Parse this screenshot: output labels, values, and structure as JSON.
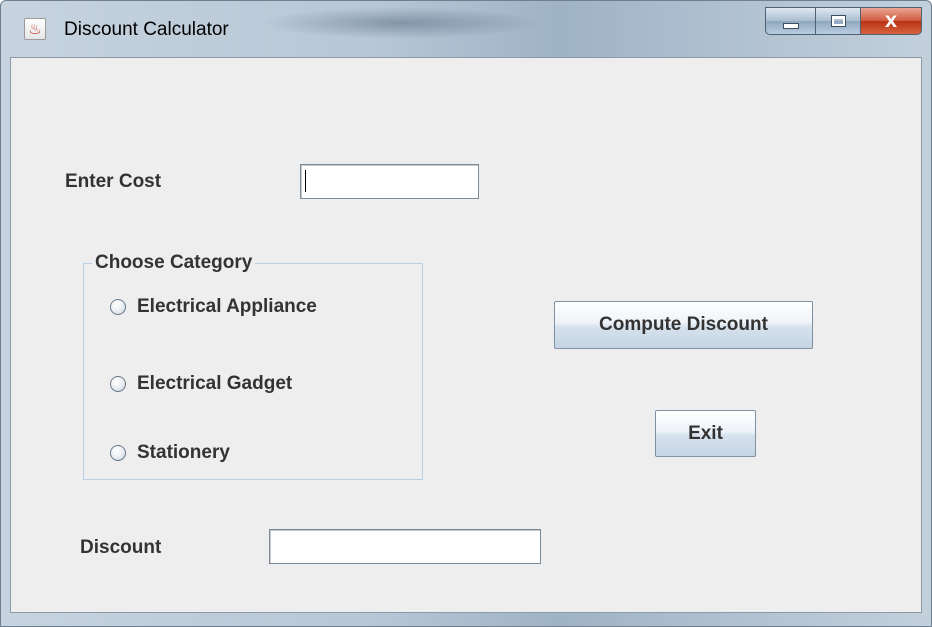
{
  "window": {
    "title": "Discount Calculator",
    "app_icon": "java-icon",
    "controls": {
      "minimize": "minimize-icon",
      "maximize": "maximize-icon",
      "close": "X"
    }
  },
  "form": {
    "cost_label": "Enter Cost",
    "cost_value": "",
    "category_group": {
      "title": "Choose Category",
      "options": [
        {
          "label": "Electrical Appliance",
          "selected": false
        },
        {
          "label": "Electrical Gadget",
          "selected": false
        },
        {
          "label": "Stationery",
          "selected": false
        }
      ]
    },
    "compute_button_label": "Compute Discount",
    "exit_button_label": "Exit",
    "discount_label": "Discount",
    "discount_value": ""
  },
  "colors": {
    "panel_bg": "#eeeeee",
    "label_text": "#333333",
    "group_border": "#b8cfe5",
    "close_red": "#c8462a"
  }
}
